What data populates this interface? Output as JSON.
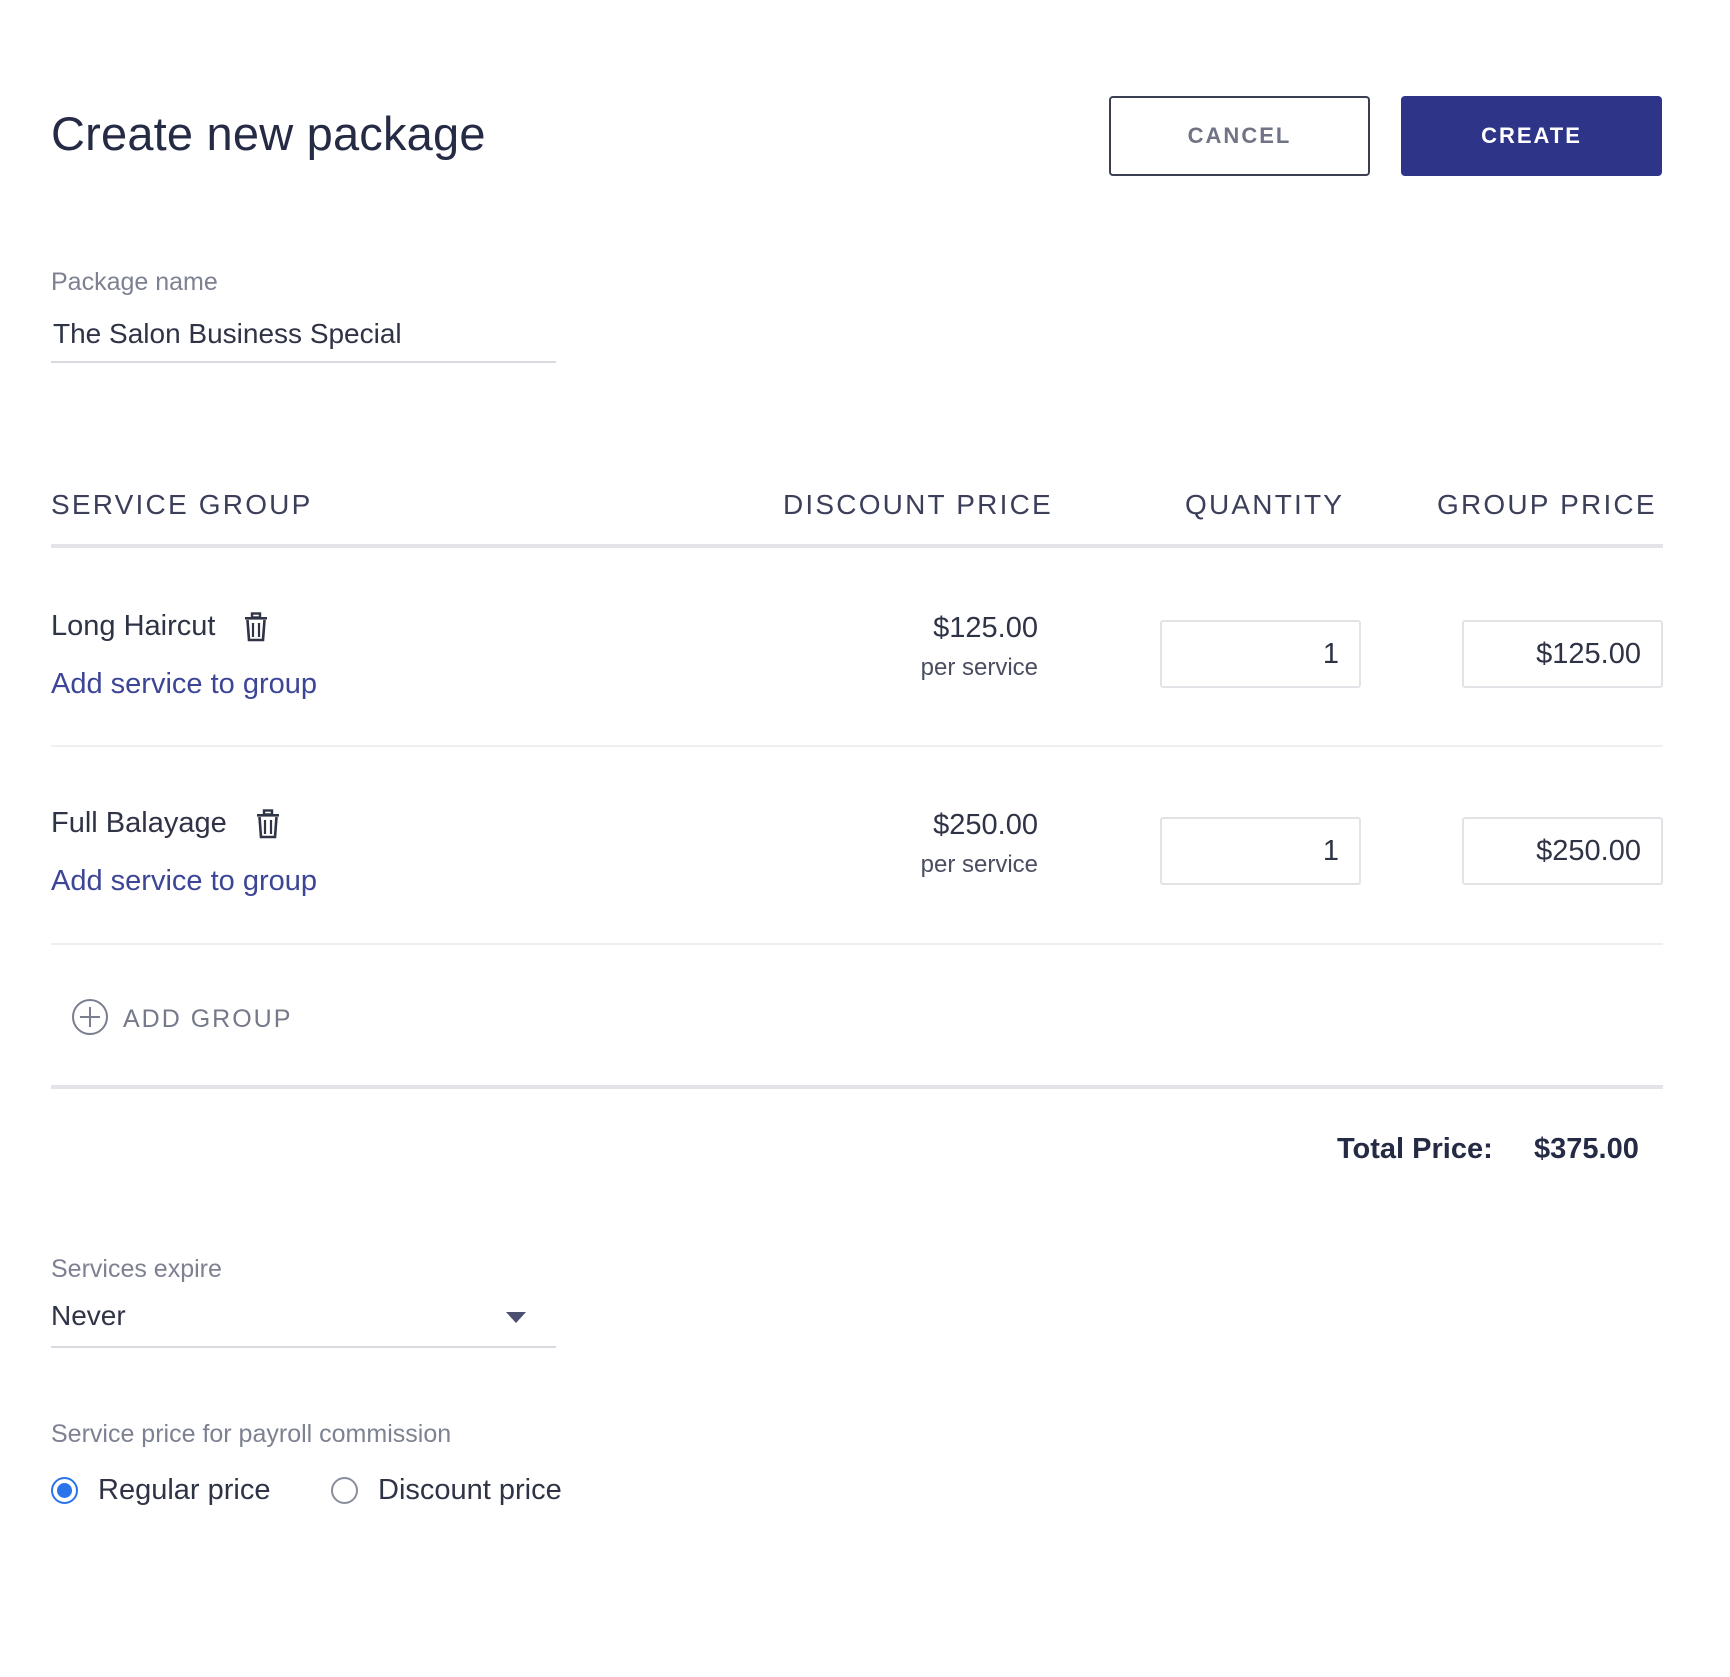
{
  "header": {
    "title": "Create new package",
    "cancel_label": "CANCEL",
    "create_label": "CREATE"
  },
  "package_name": {
    "label": "Package name",
    "value": "The Salon Business Special"
  },
  "table": {
    "headers": [
      "SERVICE GROUP",
      "DISCOUNT PRICE",
      "QUANTITY",
      "GROUP PRICE"
    ],
    "rows": [
      {
        "name": "Long Haircut",
        "add_service": "Add service to group",
        "discount_price": "$125.00",
        "per": "per service",
        "quantity": "1",
        "group_price": "$125.00"
      },
      {
        "name": "Full Balayage",
        "add_service": "Add service to group",
        "discount_price": "$250.00",
        "per": "per service",
        "quantity": "1",
        "group_price": "$250.00"
      }
    ],
    "add_group_label": "ADD GROUP"
  },
  "total": {
    "label": "Total Price:",
    "value": "$375.00"
  },
  "services_expire": {
    "label": "Services expire",
    "value": "Never"
  },
  "payroll": {
    "label": "Service price for payroll commission",
    "options": [
      {
        "label": "Regular price",
        "checked": true
      },
      {
        "label": "Discount price",
        "checked": false
      }
    ]
  },
  "colors": {
    "primary": "#2e3588",
    "link": "#3d4696",
    "radio_active": "#2b73ea"
  }
}
